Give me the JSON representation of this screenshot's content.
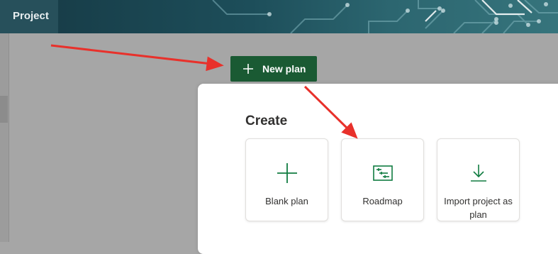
{
  "header": {
    "app_title": "Project"
  },
  "toolbar": {
    "new_plan_label": "New plan"
  },
  "create_panel": {
    "heading": "Create",
    "options": [
      {
        "label": "Blank plan",
        "icon": "plus-icon"
      },
      {
        "label": "Roadmap",
        "icon": "roadmap-icon"
      },
      {
        "label": "Import project as plan",
        "icon": "import-icon"
      }
    ]
  },
  "colors": {
    "accent_green": "#1a5a33",
    "icon_green": "#107c41",
    "annotation_red": "#e8312b"
  }
}
